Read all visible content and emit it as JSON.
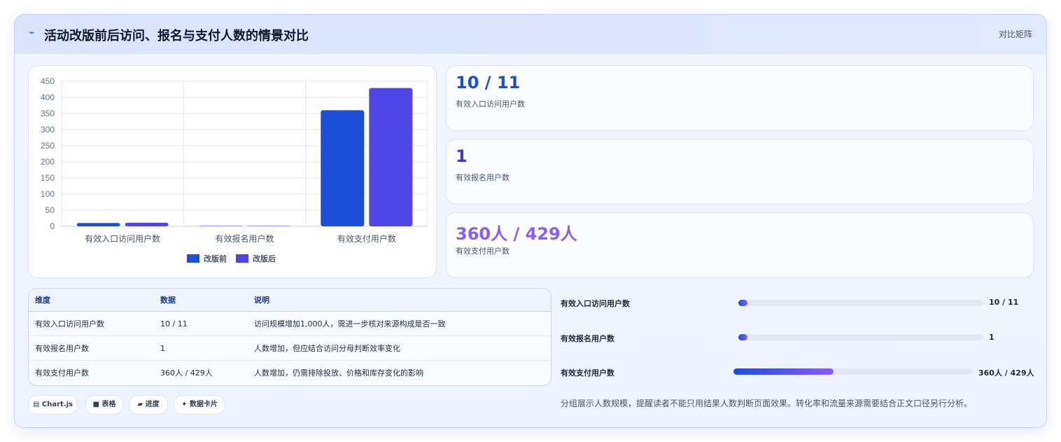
{
  "header": {
    "icon": "trend-line-icon",
    "title": "活动改版前后访问、报名与支付人数的情景对比",
    "right_label": "对比矩阵"
  },
  "chart_data": {
    "type": "bar",
    "categories": [
      "有效入口访问用户数",
      "有效报名用户数",
      "有效支付用户数"
    ],
    "series": [
      {
        "name": "改版前",
        "values": [
          10,
          1,
          360
        ],
        "color": "#1d4ed8"
      },
      {
        "name": "改版后",
        "values": [
          11,
          1,
          429
        ],
        "color": "#4f46e5"
      }
    ],
    "ylim": [
      0,
      450
    ],
    "yticks": [
      0,
      50,
      100,
      150,
      200,
      250,
      300,
      350,
      400,
      450
    ],
    "legend": "bottom",
    "grid": true
  },
  "stats": [
    {
      "value": "10 / 11",
      "label": "有效入口访问用户数",
      "color": "#1d4ed8"
    },
    {
      "value": "1",
      "label": "有效报名用户数",
      "color": "#4338ca"
    },
    {
      "value": "360人 / 429人",
      "label": "有效支付用户数",
      "color": "#8b5cf6"
    }
  ],
  "table": {
    "headers": [
      "维度",
      "数据",
      "说明"
    ],
    "rows": [
      [
        "有效入口访问用户数",
        "10 / 11",
        "访问规模增加1,000人，需进一步核对来源构成是否一致"
      ],
      [
        "有效报名用户数",
        "1",
        "人数增加，但应结合访问分母判断效率变化"
      ],
      [
        "有效支付用户数",
        "360人 / 429人",
        "人数增加，仍需排除投放、价格和库存变化的影响"
      ]
    ]
  },
  "tags": [
    {
      "icon": "chart-icon",
      "glyph": "▤",
      "label": "Chart.js"
    },
    {
      "icon": "table-icon",
      "glyph": "■",
      "label": "表格"
    },
    {
      "icon": "folder-icon",
      "glyph": "▰",
      "label": "进度"
    },
    {
      "icon": "sparkle-icon",
      "glyph": "✦",
      "label": "数据卡片"
    }
  ],
  "progress": [
    {
      "label": "有效入口访问用户数",
      "value_text": "10 / 11",
      "fraction": 0.02
    },
    {
      "label": "有效报名用户数",
      "value_text": "1",
      "fraction": 0.015
    },
    {
      "label": "有效支付用户数",
      "value_text": "360人 / 429人",
      "fraction": 0.42
    }
  ],
  "note": "分组展示人数规模，提醒读者不能只用结果人数判断页面效果。转化率和流量来源需要结合正文口径另行分析。"
}
